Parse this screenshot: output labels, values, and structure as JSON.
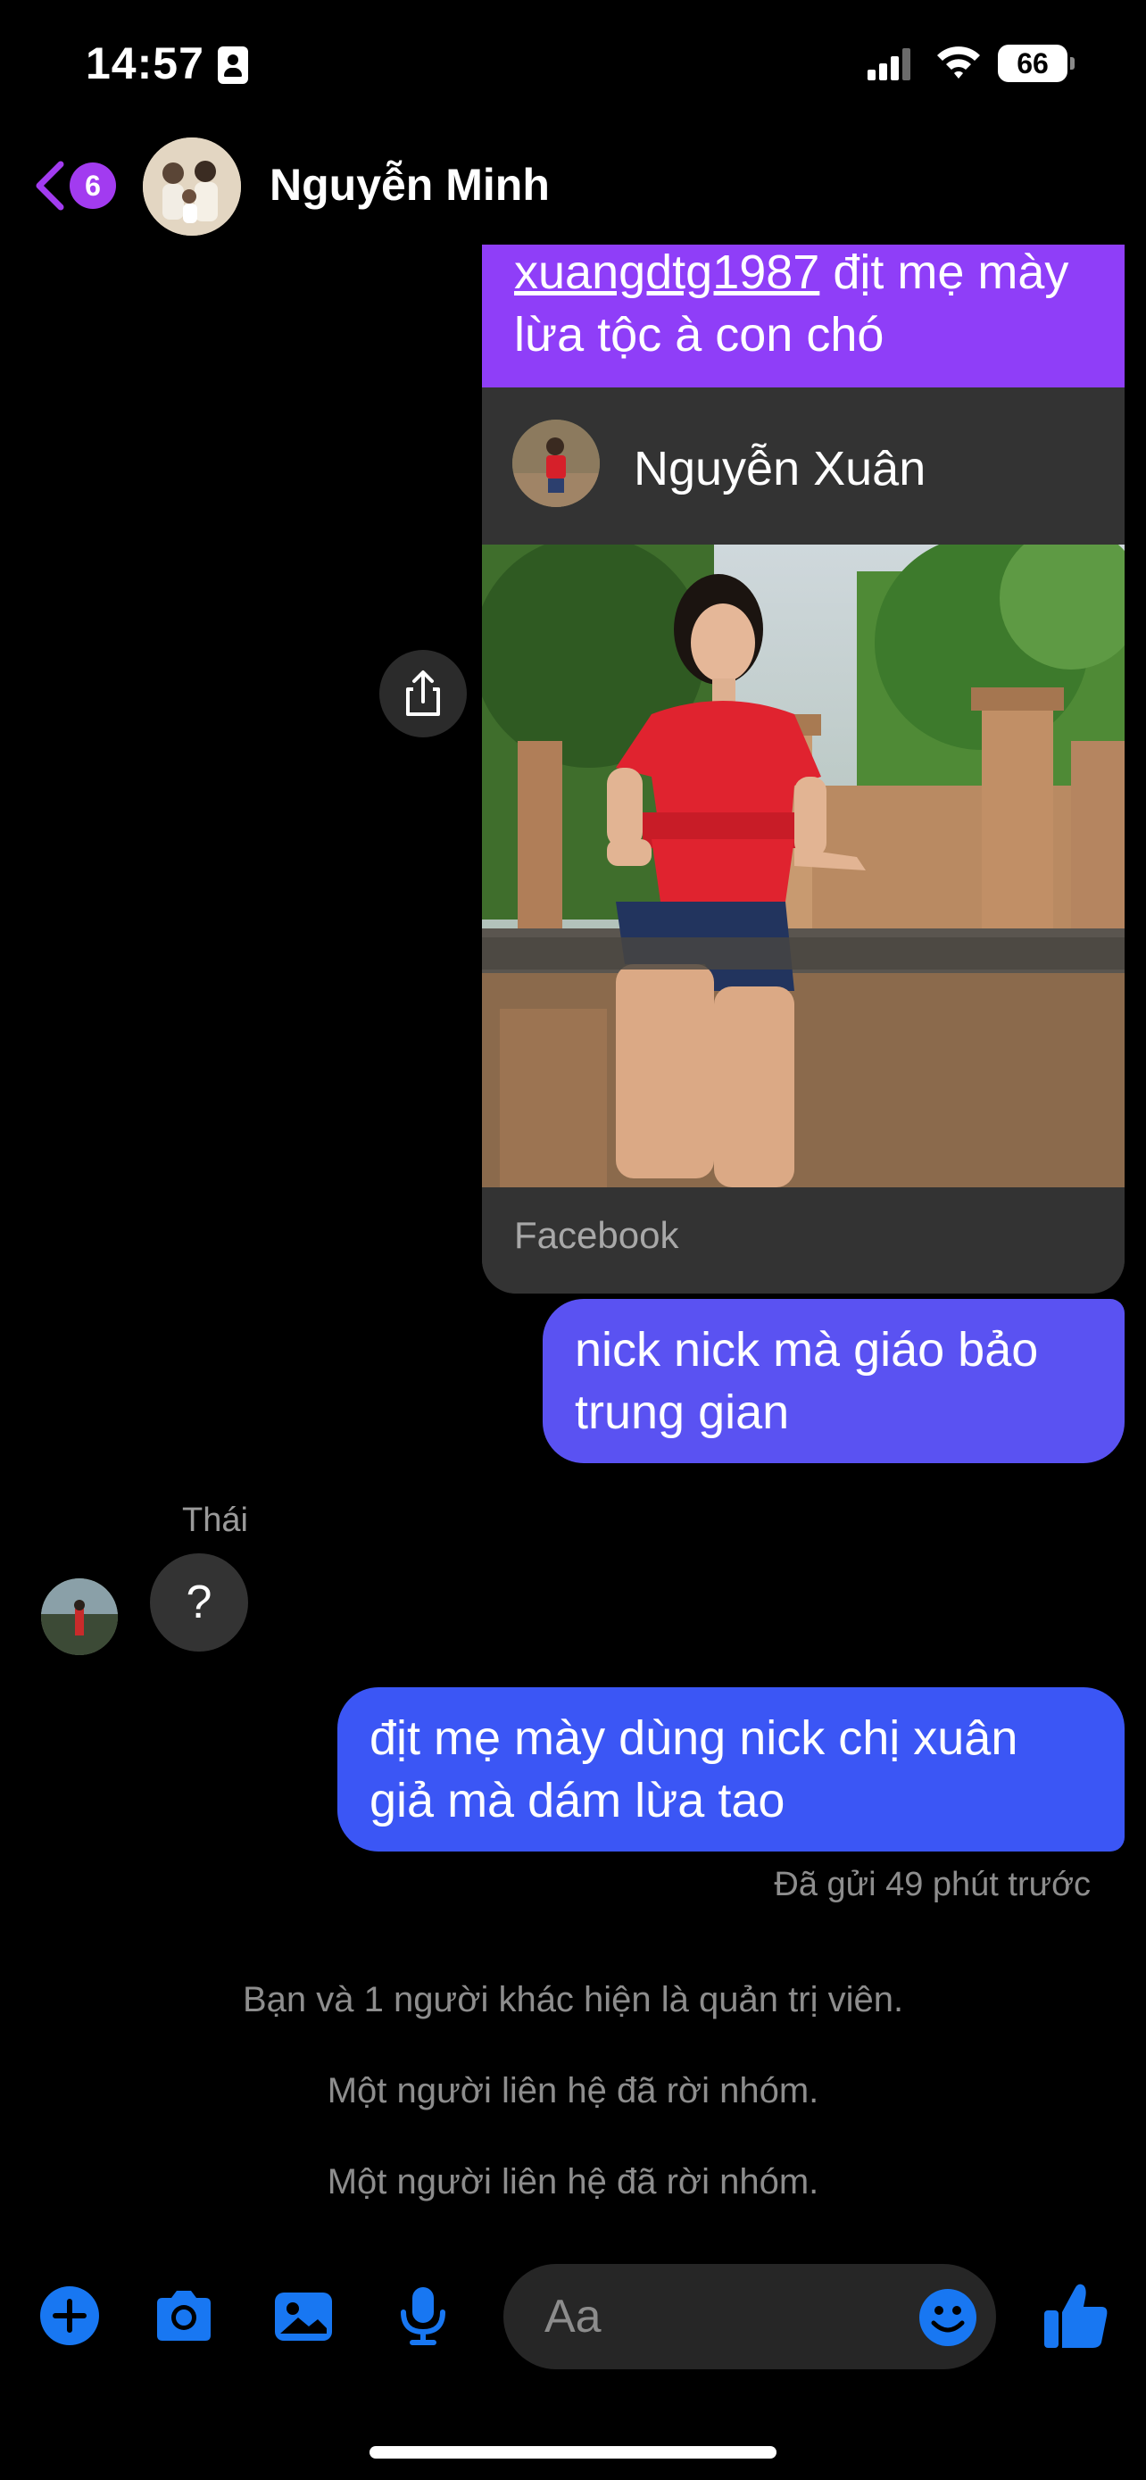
{
  "status_bar": {
    "time": "14:57",
    "battery": "66"
  },
  "header": {
    "unread_count": "6",
    "title": "Nguyễn Minh"
  },
  "shared_post": {
    "mention": "xuangdtg1987",
    "text_after_mention": " địt mẹ mày lừa tộc à con chó",
    "profile_name": "Nguyễn Xuân",
    "source": "Facebook"
  },
  "messages": [
    {
      "direction": "outgoing",
      "text": "nick nick mà giáo bảo trung gian"
    },
    {
      "direction": "incoming",
      "sender": "Thái",
      "text": "?"
    },
    {
      "direction": "outgoing",
      "text": "địt mẹ mày dùng nick chị xuân giả mà dám lừa tao"
    }
  ],
  "sent_status": "Đã gửi 49 phút trước",
  "system_messages": [
    "Bạn và 1 người khác hiện là quản trị viên.",
    "Một người liên hệ đã rời nhóm.",
    "Một người liên hệ đã rời nhóm."
  ],
  "composer": {
    "placeholder": "Aa"
  },
  "colors": {
    "accent": "#1877f2",
    "badge": "#a23bf0",
    "bubble_purple": "#8f3ef8",
    "bubble_indigo": "#5a52f2",
    "bubble_blue": "#3b56f5"
  },
  "icons": [
    "contact-card-icon",
    "signal-icon",
    "wifi-icon",
    "battery-icon",
    "back-chevron-icon",
    "share-icon",
    "plus-icon",
    "camera-icon",
    "image-icon",
    "microphone-icon",
    "emoji-icon",
    "thumbs-up-icon"
  ]
}
